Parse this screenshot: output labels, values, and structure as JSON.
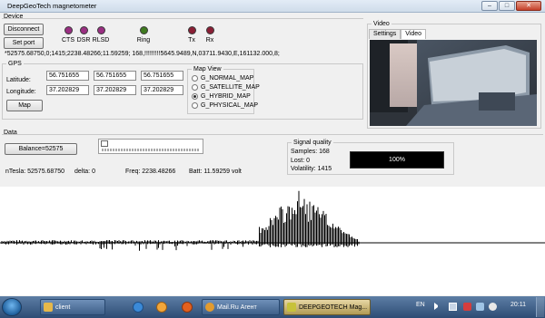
{
  "window": {
    "title": "DeepGeoTech magnetometer",
    "min": "–",
    "max": "□",
    "close": "✕"
  },
  "device": {
    "label": "Device",
    "disconnect_label": "Disconnect",
    "set_port_label": "Set port",
    "leds": [
      {
        "label": "CTS",
        "color": "#9a2f82"
      },
      {
        "label": "DSR",
        "color": "#9a2f82"
      },
      {
        "label": "RLSD",
        "color": "#9a2f82"
      },
      {
        "label": "Ring",
        "color": "#3f7a1f"
      },
      {
        "label": "Tx",
        "color": "#8a1f35"
      },
      {
        "label": "Rx",
        "color": "#8a1f35"
      }
    ],
    "data_line": "*52575.68750,0;1415;2238.48266;11.59259; 168,!!!!!!!!!5645.9489,N,03711.9430,E,161132.000,8;"
  },
  "gps": {
    "label": "GPS",
    "latitude_label": "Latitude:",
    "longitude_label": "Longitude:",
    "latitude_values": [
      "56.751655",
      "56.751655",
      "56.751655"
    ],
    "longitude_values": [
      "37.202829",
      "37.202829",
      "37.202829"
    ],
    "map_button_label": "Map",
    "map_view": {
      "label": "Map View",
      "options": [
        "G_NORMAL_MAP",
        "G_SATELLITE_MAP",
        "G_HYBRID_MAP",
        "G_PHYSICAL_MAP"
      ],
      "selected": "G_HYBRID_MAP"
    }
  },
  "video": {
    "label": "Video",
    "tabs": [
      "Settings",
      "Video"
    ],
    "active_tab": "Video"
  },
  "data_section": {
    "label": "Data",
    "balance_button_label": "Balance=52575",
    "ntesla": "nTesla: 52575.68750",
    "delta": "delta: 0",
    "freq": "Freq: 2238.48266",
    "batt": "Batt: 11.59259 volt"
  },
  "signal_quality": {
    "label": "Signal quality",
    "samples": "Samples:  168",
    "lost": "Lost: 0",
    "volatility": "Volatility: 1415",
    "progress_text": "100%",
    "progress_fraction": 1.0
  },
  "taskbar": {
    "items": [
      {
        "label": "client",
        "icon_color": "#e6b84a"
      },
      {
        "label": "Mail.Ru Агент",
        "icon_color": "#e39b2e"
      },
      {
        "label": "DEEPGEOTECH Mag...",
        "icon_color": "#c7c23a"
      }
    ],
    "lang": "EN",
    "clock": "20:11"
  }
}
